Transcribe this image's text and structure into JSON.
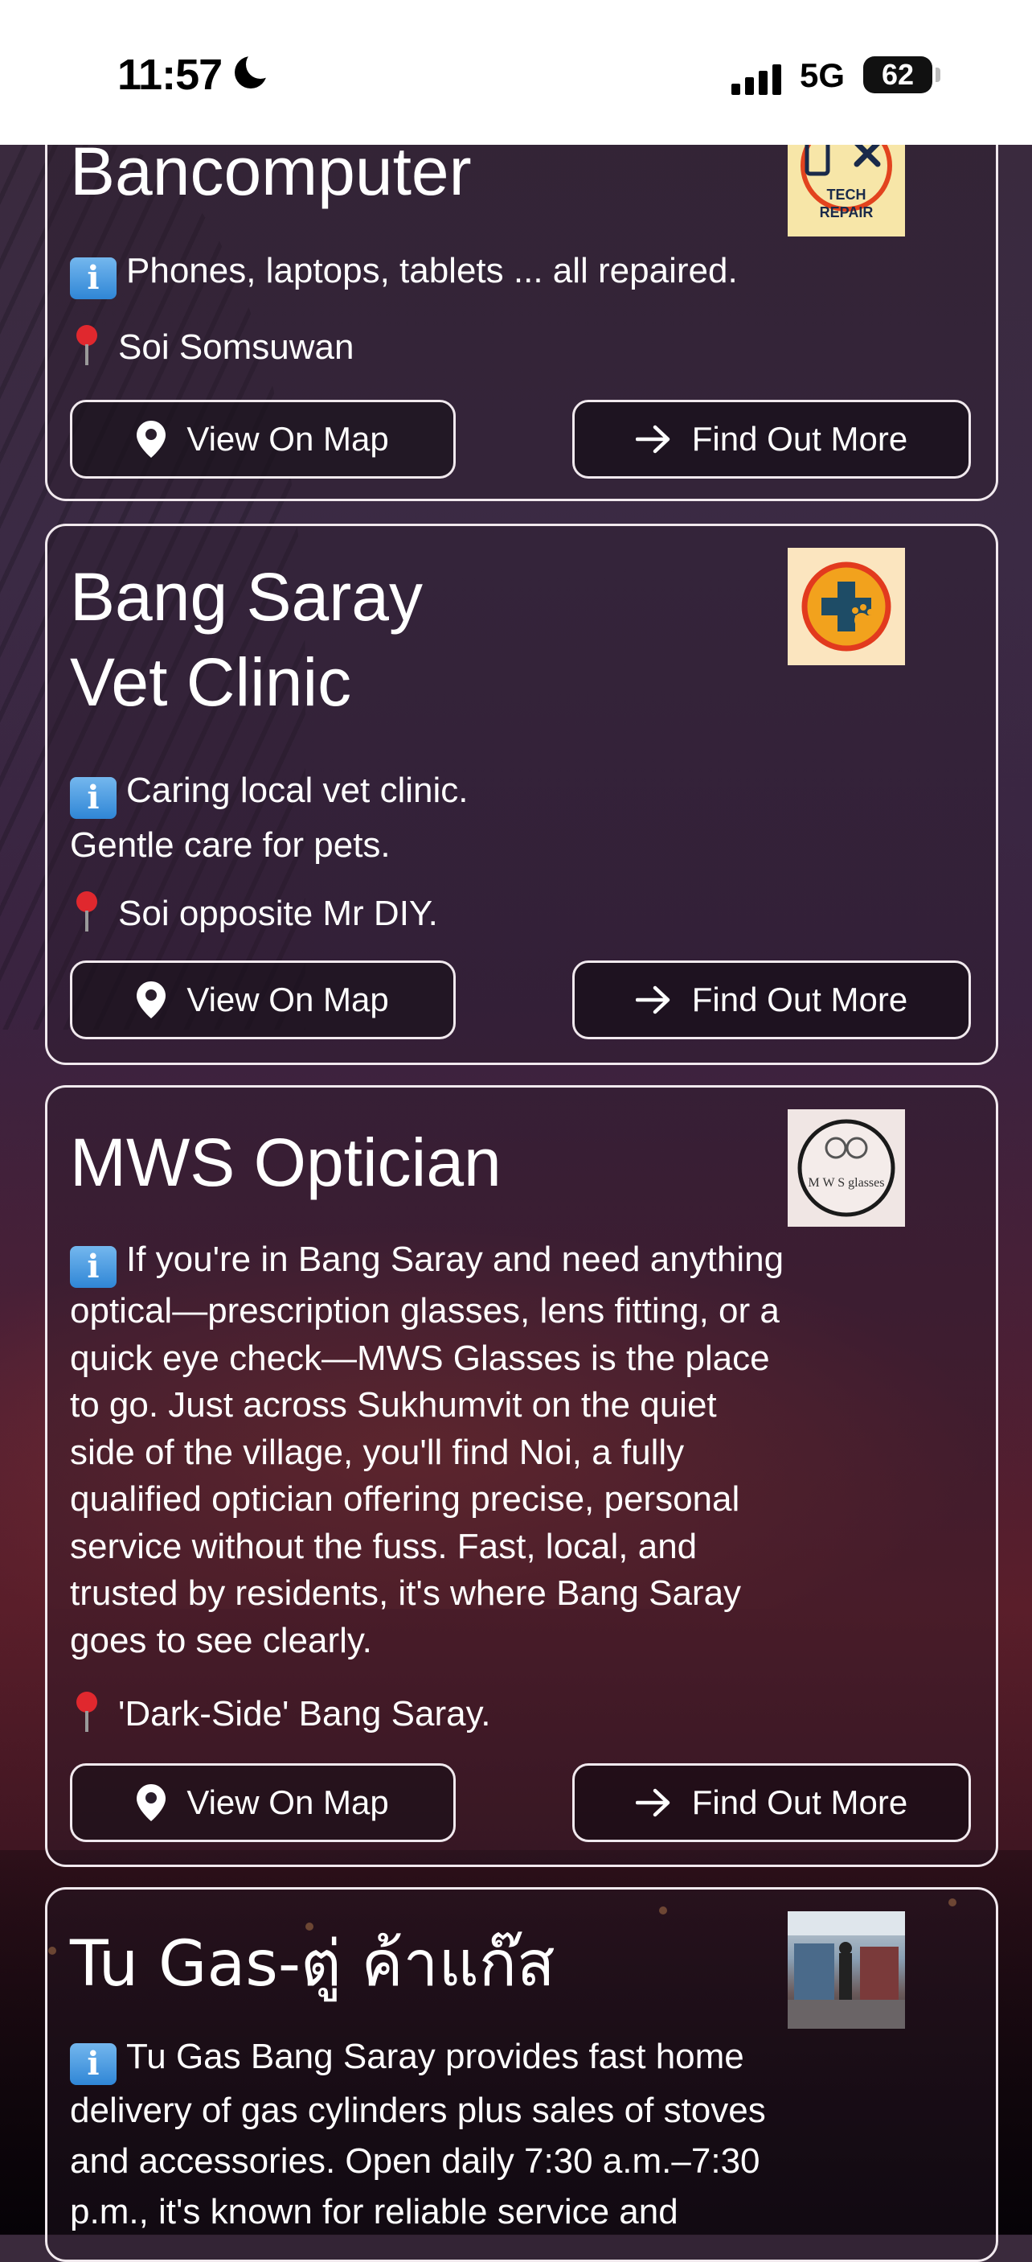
{
  "status_bar": {
    "time": "11:57",
    "network": "5G",
    "battery": "62"
  },
  "buttons": {
    "map_label": "View On Map",
    "more_label": "Find Out More"
  },
  "listings": [
    {
      "title": "Bancomputer",
      "thumb_label": "TECH REPAIR",
      "description": "Phones, laptops, tablets ... all repaired.",
      "location": "Soi Somsuwan"
    },
    {
      "title_line1": "Bang Saray",
      "title_line2": "Vet Clinic",
      "description_line1": "Caring local vet clinic.",
      "description_line2": "Gentle care for pets.",
      "location": "Soi opposite Mr DIY."
    },
    {
      "title": "MWS Optician",
      "thumb_label": "M W S glasses",
      "description_lines": [
        "If you're in Bang Saray and need anything",
        "optical—prescription glasses, lens fitting, or a",
        "quick eye check—MWS Glasses is the place",
        "to go. Just across Sukhumvit on the quiet",
        "side of the village, you'll find Noi, a fully",
        "qualified optician offering precise, personal",
        "service without the fuss. Fast, local, and",
        "trusted by residents, it's where Bang Saray",
        "goes to see clearly."
      ],
      "location": "'Dark-Side' Bang Saray."
    },
    {
      "title": "Tu Gas-ตู่ ค้าแก๊ส",
      "description_lines": [
        "Tu Gas Bang Saray provides fast home",
        "delivery of gas cylinders plus sales of stoves",
        "and accessories. Open daily 7:30 a.m.–7:30",
        "p.m., it's known for reliable service and"
      ]
    }
  ]
}
